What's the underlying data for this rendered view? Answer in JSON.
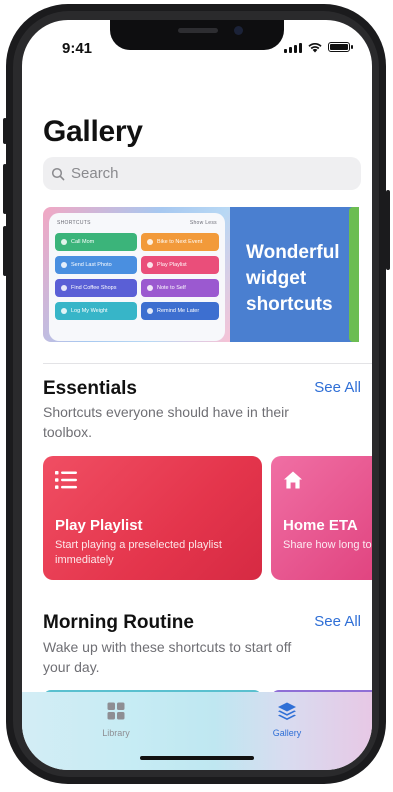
{
  "status_bar": {
    "time": "9:41"
  },
  "page": {
    "title": "Gallery"
  },
  "search": {
    "placeholder": "Search"
  },
  "hero": {
    "headline": "Wonderful widget shortcuts",
    "widget": {
      "app_label": "SHORTCUTS",
      "toggle_label": "Show Less",
      "buttons": [
        {
          "label": "Call Mom",
          "color": "#3bb47a"
        },
        {
          "label": "Bike to Next Event",
          "color": "#f29a3a"
        },
        {
          "label": "Send Last Photo",
          "color": "#4a8fe0"
        },
        {
          "label": "Play Playlist",
          "color": "#ea4e7a"
        },
        {
          "label": "Find Coffee Shops",
          "color": "#5a5fd6"
        },
        {
          "label": "Note to Self",
          "color": "#9b59d0"
        },
        {
          "label": "Log My Weight",
          "color": "#37b5c8"
        },
        {
          "label": "Remind Me Later",
          "color": "#3d6fd0"
        }
      ]
    }
  },
  "essentials": {
    "title": "Essentials",
    "see_all": "See All",
    "description": "Shortcuts everyone should have in their toolbox.",
    "cards": [
      {
        "title": "Play Playlist",
        "subtitle": "Start playing a preselected playlist immediately",
        "icon": "list-icon"
      },
      {
        "title": "Home ETA",
        "subtitle": "Share how long to get home",
        "icon": "house-icon"
      }
    ]
  },
  "morning_routine": {
    "title": "Morning Routine",
    "see_all": "See All",
    "description": "Wake up with these shortcuts to start off your day."
  },
  "tab_bar": {
    "tabs": [
      {
        "label": "Library",
        "icon": "grid-icon",
        "active": false,
        "color": "#8e8e93"
      },
      {
        "label": "Gallery",
        "icon": "layers-icon",
        "active": true,
        "color": "#2f6fd6"
      }
    ]
  }
}
